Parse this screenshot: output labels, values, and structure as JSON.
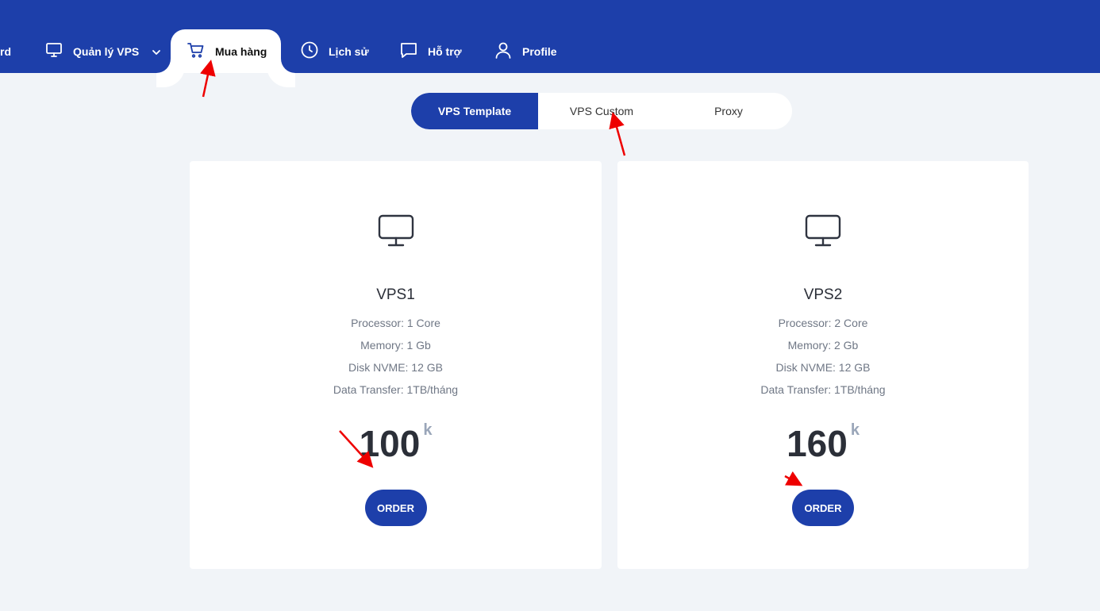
{
  "nav": {
    "items": [
      {
        "label": "rd",
        "icon": "dashboard-icon"
      },
      {
        "label": "Quản lý VPS",
        "icon": "monitor-icon",
        "has_dropdown": true
      },
      {
        "label": "Mua hàng",
        "icon": "cart-icon",
        "active": true
      },
      {
        "label": "Lịch sử",
        "icon": "clock-icon"
      },
      {
        "label": "Hỗ trợ",
        "icon": "chat-icon"
      },
      {
        "label": "Profile",
        "icon": "user-icon"
      }
    ]
  },
  "tabs": [
    {
      "label": "VPS Template",
      "active": true
    },
    {
      "label": "VPS Custom"
    },
    {
      "label": "Proxy"
    }
  ],
  "plans": [
    {
      "name": "VPS1",
      "specs": [
        "Processor: 1 Core",
        "Memory: 1 Gb",
        "Disk NVME: 12 GB",
        "Data Transfer: 1TB/tháng"
      ],
      "price": "100",
      "unit": "k",
      "order_label": "ORDER"
    },
    {
      "name": "VPS2",
      "specs": [
        "Processor: 2 Core",
        "Memory: 2 Gb",
        "Disk NVME: 12 GB",
        "Data Transfer: 1TB/tháng"
      ],
      "price": "160",
      "unit": "k",
      "order_label": "ORDER"
    }
  ],
  "colors": {
    "brand": "#1d3faa",
    "background": "#f1f4f8",
    "annotation_arrow": "#ee0000"
  }
}
